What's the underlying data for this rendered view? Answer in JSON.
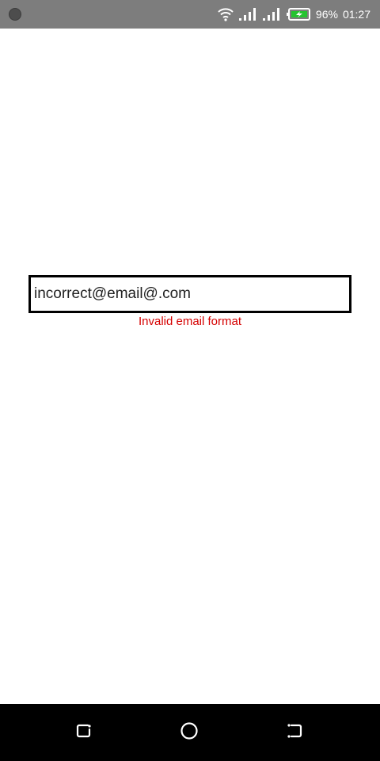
{
  "status_bar": {
    "battery_percent": "96%",
    "time": "01:27",
    "icons": [
      "wifi-icon",
      "signal-icon",
      "signal-icon",
      "battery-charging-icon"
    ],
    "background_color": "#7d7d7d"
  },
  "form": {
    "email_value": "incorrect@email@.com",
    "error_message": "Invalid email format",
    "error_color": "#d50000"
  },
  "nav_bar": {
    "icons": [
      "recent-apps-icon",
      "home-icon",
      "back-icon"
    ],
    "background_color": "#000000"
  }
}
